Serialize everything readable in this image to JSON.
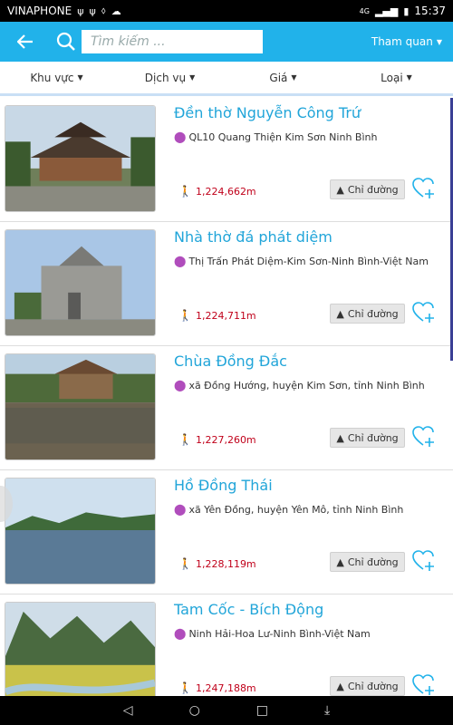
{
  "status": {
    "carrier": "VINAPHONE",
    "network": "4G",
    "time": "15:37"
  },
  "appbar": {
    "back_icon": "back-arrow-icon",
    "search_placeholder": "Tìm kiếm ...",
    "type_label": "Tham quan"
  },
  "filters": [
    {
      "label": "Khu vực"
    },
    {
      "label": "Dịch vụ"
    },
    {
      "label": "Giá"
    },
    {
      "label": "Loại"
    }
  ],
  "items": [
    {
      "title": "Đền thờ Nguyễn Công Trứ",
      "address": "QL10 Quang Thiện Kim Sơn Ninh Bình",
      "distance": "1,224,662m",
      "directions": "Chỉ đường"
    },
    {
      "title": "Nhà thờ đá phát diệm",
      "address": "Thị Trấn Phát Diệm-Kim Sơn-Ninh Bình-Việt Nam",
      "distance": "1,224,711m",
      "directions": "Chỉ đường"
    },
    {
      "title": "Chùa Đồng Đắc",
      "address": "xã Đồng Hướng, huyện Kim Sơn, tỉnh Ninh Bình",
      "distance": "1,227,260m",
      "directions": "Chỉ đường"
    },
    {
      "title": "Hồ Đồng Thái",
      "address": "xã Yên Đồng, huyện Yên Mô, tỉnh Ninh Bình",
      "distance": "1,228,119m",
      "directions": "Chỉ đường"
    },
    {
      "title": "Tam Cốc - Bích Động",
      "address": "Ninh Hải-Hoa Lư-Ninh Bình-Việt Nam",
      "distance": "1,247,188m",
      "directions": "Chỉ đường"
    }
  ],
  "colors": {
    "accent": "#21b2ea",
    "title": "#21a5d9",
    "distance": "#c0001a",
    "pin": "#b04dbc"
  }
}
